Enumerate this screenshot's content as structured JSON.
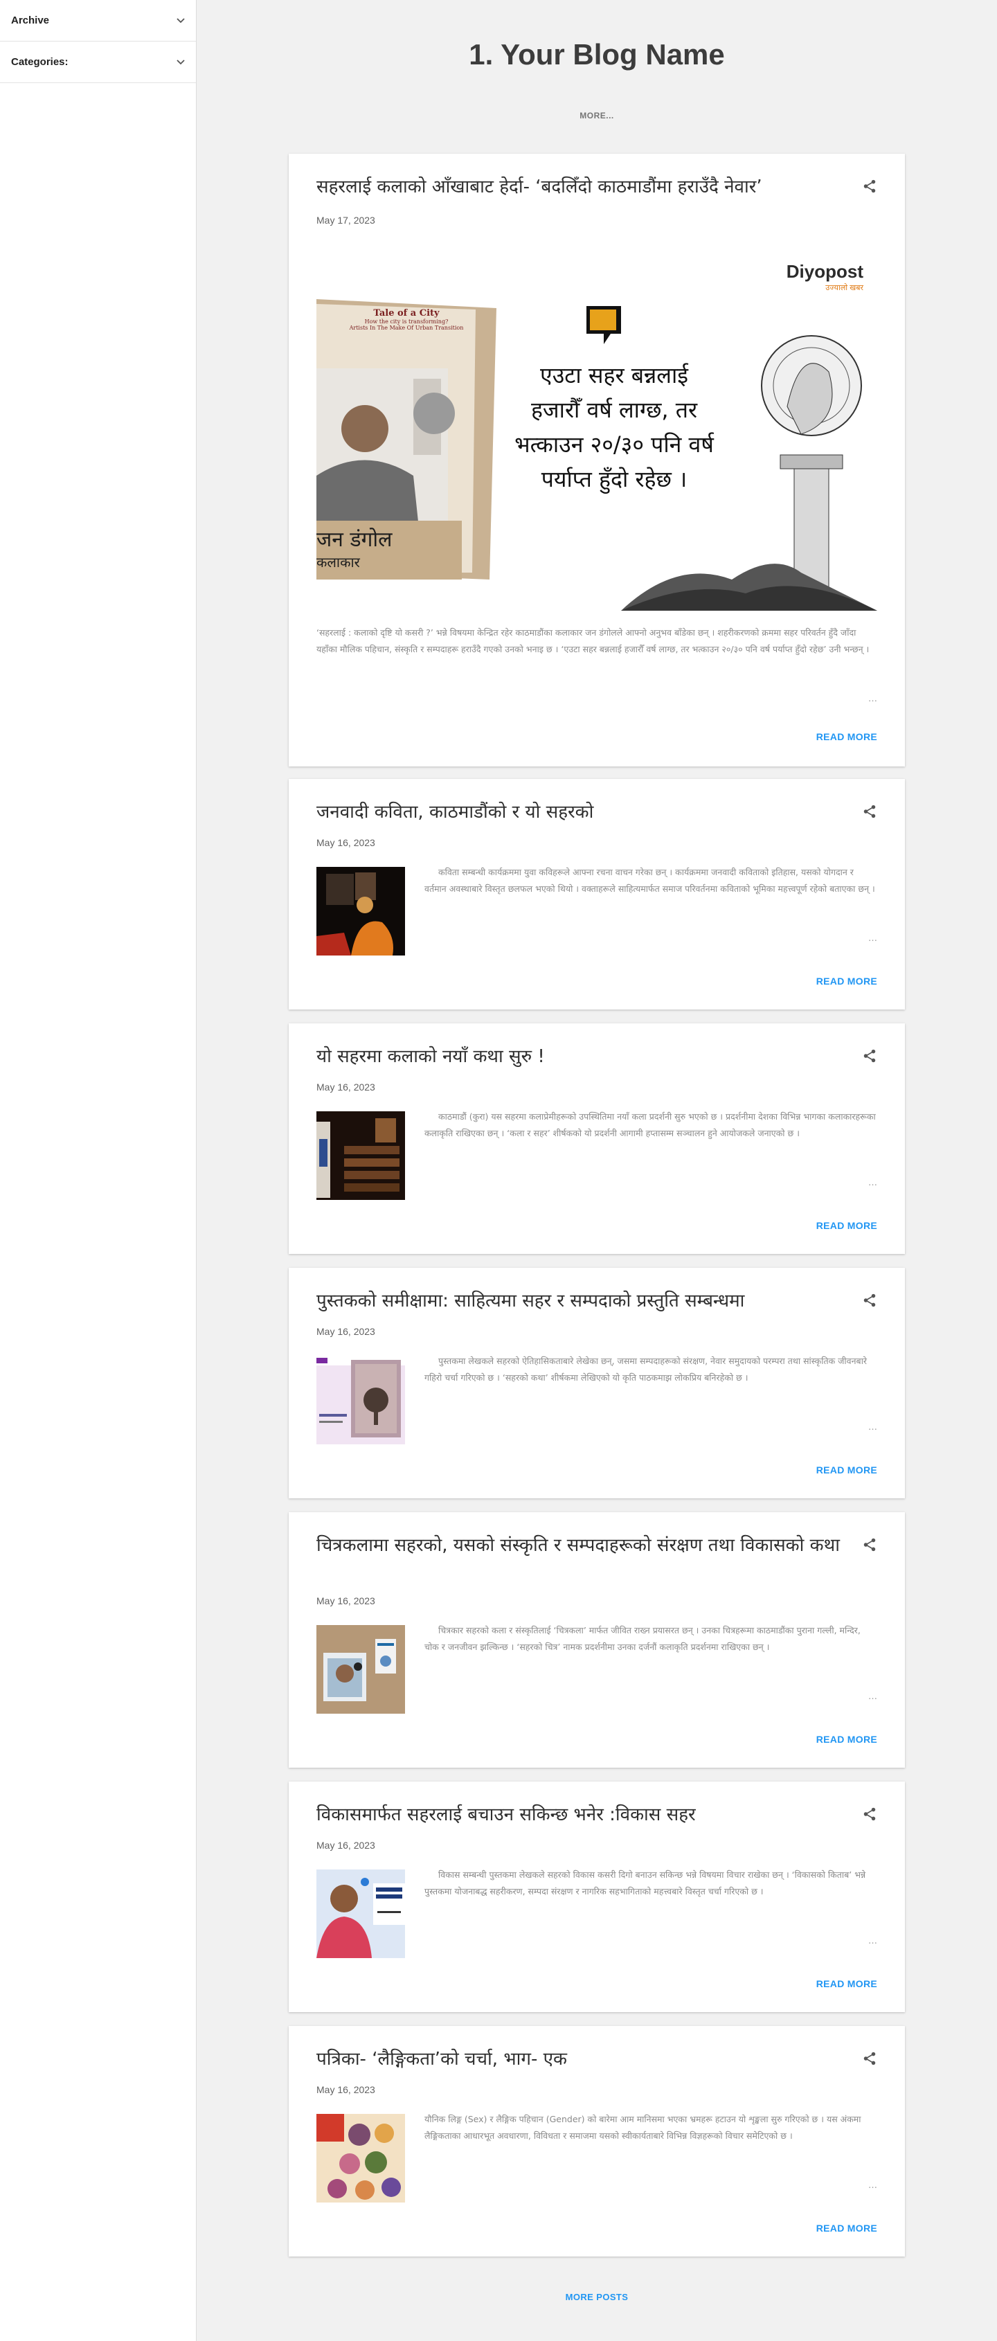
{
  "sidebar": {
    "items": [
      {
        "label": "Archive"
      },
      {
        "label": "Categories:"
      }
    ]
  },
  "header": {
    "title": "1. Your Blog Name",
    "more_label": "MORE..."
  },
  "featured_image": {
    "brand": "Diyopost",
    "brand_tag": "उज्यालो खबर",
    "quote": [
      "एउटा सहर बन्नलाई",
      "हजारौँ वर्ष लाग्छ, तर",
      "भत्काउन २०/३० पनि वर्ष",
      "पर्याप्त हुँदो रहेछ ।"
    ],
    "book_title": "Tale of a City",
    "book_subtitle": "How the city is transforming?",
    "book_subtitle2": "Artists In The Make Of Urban Transition",
    "person_name": "जन डंगोल",
    "person_role": "कलाकार"
  },
  "posts": [
    {
      "title": "सहरलाई कलाको आँखाबाट हेर्दा- ‘बदलिँदो काठमाडौंमा हराउँदै नेवार’",
      "date": "May 17, 2023",
      "snippet": "‘सहरलाई : कलाको दृष्टि यो कसरी ?’ भन्ने विषयमा केन्द्रित रहेर काठमाडौंका कलाकार जन डंगोलले आफ्नो अनुभव बाँडेका छन् । शहरीकरणको क्रममा सहर परिवर्तन हुँदै जाँदा यहाँका मौलिक पहिचान, संस्कृति र सम्पदाहरू हराउँदै गएको उनको भनाइ छ । ‘एउटा सहर बन्नलाई हजारौँ वर्ष लाग्छ, तर भत्काउन २०/३० पनि वर्ष पर्याप्त हुँदो रहेछ’ उनी भन्छन् ।",
      "read_more": "READ MORE"
    },
    {
      "title": "जनवादी कविता, काठमाडौंको र यो सहरको",
      "date": "May 16, 2023",
      "snippet": "कविता सम्बन्धी कार्यक्रममा युवा कविहरूले आफ्ना रचना वाचन गरेका छन् । कार्यक्रममा जनवादी कविताको इतिहास, यसको योगदान र वर्तमान अवस्थाबारे विस्तृत छलफल भएको थियो । वक्ताहरूले साहित्यमार्फत समाज परिवर्तनमा कविताको भूमिका महत्त्वपूर्ण रहेको बताएका छन् ।",
      "read_more": "READ MORE"
    },
    {
      "title": "यो सहरमा कलाको नयाँ कथा सुरु !",
      "date": "May 16, 2023",
      "snippet": "काठमाडौं (कुरा) यस सहरमा कलाप्रेमीहरूको उपस्थितिमा नयाँ कला प्रदर्शनी सुरु भएको छ । प्रदर्शनीमा देशका विभिन्न भागका कलाकारहरूका कलाकृति राखिएका छन् । ‘कला र सहर’ शीर्षकको यो प्रदर्शनी आगामी हप्तासम्म सञ्चालन हुने आयोजकले जनाएको छ ।",
      "read_more": "READ MORE"
    },
    {
      "title": "पुस्तकको समीक्षामा: साहित्यमा सहर र सम्पदाको प्रस्तुति सम्बन्धमा",
      "date": "May 16, 2023",
      "snippet": "पुस्तकमा लेखकले सहरको ऐतिहासिकताबारे लेखेका छन्, जसमा सम्पदाहरूको संरक्षण, नेवार समुदायको परम्परा तथा सांस्कृतिक जीवनबारे गहिरो चर्चा गरिएको छ । ‘सहरको कथा’ शीर्षकमा लेखिएको यो कृति पाठकमाझ लोकप्रिय बनिरहेको छ ।",
      "read_more": "READ MORE"
    },
    {
      "title": "चित्रकलामा सहरको, यसको संस्कृति र सम्पदाहरूको संरक्षण तथा विकासको कथा",
      "date": "May 16, 2023",
      "snippet": "चित्रकार सहरको कला र संस्कृतिलाई ‘चित्रकला’ मार्फत जीवित राख्न प्रयासरत छन् । उनका चित्रहरूमा काठमाडौंका पुराना गल्ली, मन्दिर, चोक र जनजीवन झल्किन्छ । ‘सहरको चित्र’ नामक प्रदर्शनीमा उनका दर्जनौं कलाकृति प्रदर्शनमा राखिएका छन् ।",
      "read_more": "READ MORE"
    },
    {
      "title": "विकासमार्फत सहरलाई बचाउन सकिन्छ भनेर :विकास सहर",
      "date": "May 16, 2023",
      "snippet": "विकास सम्बन्धी पुस्तकमा लेखकले सहरको विकास कसरी दिगो बनाउन सकिन्छ भन्ने विषयमा विचार राखेका छन् । ‘विकासको किताब’ भन्ने पुस्तकमा योजनाबद्ध सहरीकरण, सम्पदा संरक्षण र नागरिक सहभागिताको महत्त्वबारे विस्तृत चर्चा गरिएको छ ।",
      "read_more": "READ MORE"
    },
    {
      "title": "पत्रिका- ‘लैङ्गिकता’को चर्चा, भाग- एक",
      "date": "May 16, 2023",
      "snippet": "यौनिक लिङ्ग (Sex) र लैङ्गिक पहिचान (Gender) को बारेमा आम मानिसमा भएका भ्रमहरू हटाउन यो शृङ्खला सुरु गरिएको छ । यस अंकमा लैङ्गिकताका आधारभूत अवधारणा, विविधता र समाजमा यसको स्वीकार्यताबारे विभिन्न विज्ञहरूको विचार समेटिएको छ ।",
      "read_more": "READ MORE"
    }
  ],
  "footer": {
    "more_posts": "MORE POSTS"
  }
}
